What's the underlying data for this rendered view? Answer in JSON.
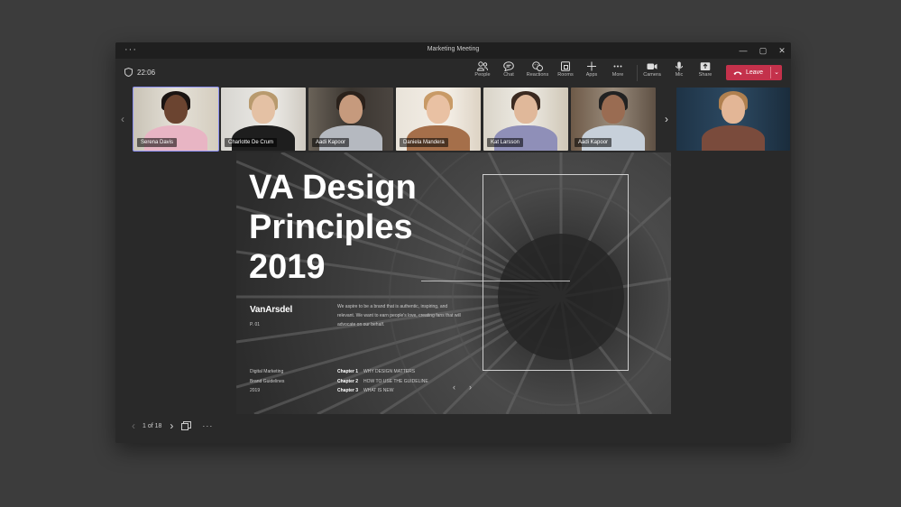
{
  "window": {
    "title": "Marketing Meeting",
    "menu": "···"
  },
  "toolbar": {
    "timer": "22:06",
    "buttons": [
      {
        "label": "People",
        "icon": "people-icon"
      },
      {
        "label": "Chat",
        "icon": "chat-icon"
      },
      {
        "label": "Reactions",
        "icon": "reactions-icon"
      },
      {
        "label": "Rooms",
        "icon": "rooms-icon"
      },
      {
        "label": "Apps",
        "icon": "plus-icon"
      },
      {
        "label": "More",
        "icon": "more-icon"
      },
      {
        "label": "Camera",
        "icon": "camera-icon"
      },
      {
        "label": "Mic",
        "icon": "mic-icon"
      },
      {
        "label": "Share",
        "icon": "share-icon"
      }
    ],
    "leave_label": "Leave",
    "leave_color": "#c4314b"
  },
  "participants": [
    {
      "name": "Serena Davis",
      "active": true
    },
    {
      "name": "Charlotte De Crum"
    },
    {
      "name": "Aadi Kapoor"
    },
    {
      "name": "Daniela Mandera"
    },
    {
      "name": "Kat Larsson"
    },
    {
      "name": "Aadi Kapoor"
    },
    {
      "name": ""
    }
  ],
  "slide": {
    "title_line1": "VA Design",
    "title_line2": "Principles",
    "title_line3": "2019",
    "logo": "VanArsdel",
    "page": "P. 01",
    "description": "We aspire to be a brand that is authentic, inspiring, and relevant. We want to earn people's love, creating fans that will advocate on our behalf.",
    "meta1": "Digital Marketing",
    "meta2": "Brand Guidelines",
    "meta3": "2019",
    "chapters": [
      {
        "label": "Chapter 1",
        "text": "WHY DESIGN MATTERS"
      },
      {
        "label": "Chapter 2",
        "text": "HOW TO USE THE GUIDELINE"
      },
      {
        "label": "Chapter 3",
        "text": "WHAT IS NEW"
      }
    ]
  },
  "pager": {
    "text": "1 of 18"
  }
}
